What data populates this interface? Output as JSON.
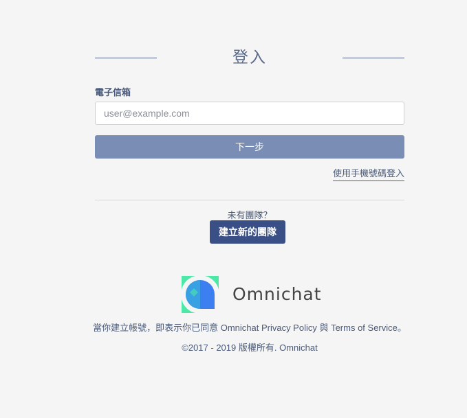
{
  "header": {
    "title": "登入"
  },
  "form": {
    "email_label": "電子信箱",
    "email_placeholder": "user@example.com",
    "email_value": "",
    "next_label": "下一步",
    "phone_login_label": "使用手機號碼登入"
  },
  "team": {
    "prompt": "未有團隊？",
    "create_label": "建立新的團隊"
  },
  "brand": {
    "name": "Omnichat",
    "colors": {
      "green": "#4de8a8",
      "blue": "#3b7ff0",
      "button": "#7a8db5",
      "primary": "#3a4f86"
    }
  },
  "footer": {
    "agreement": "當你建立帳號，即表示你已同意 Omnichat Privacy Policy 與 Terms of Service。",
    "copyright": "©2017 - 2019 版權所有. Omnichat"
  }
}
